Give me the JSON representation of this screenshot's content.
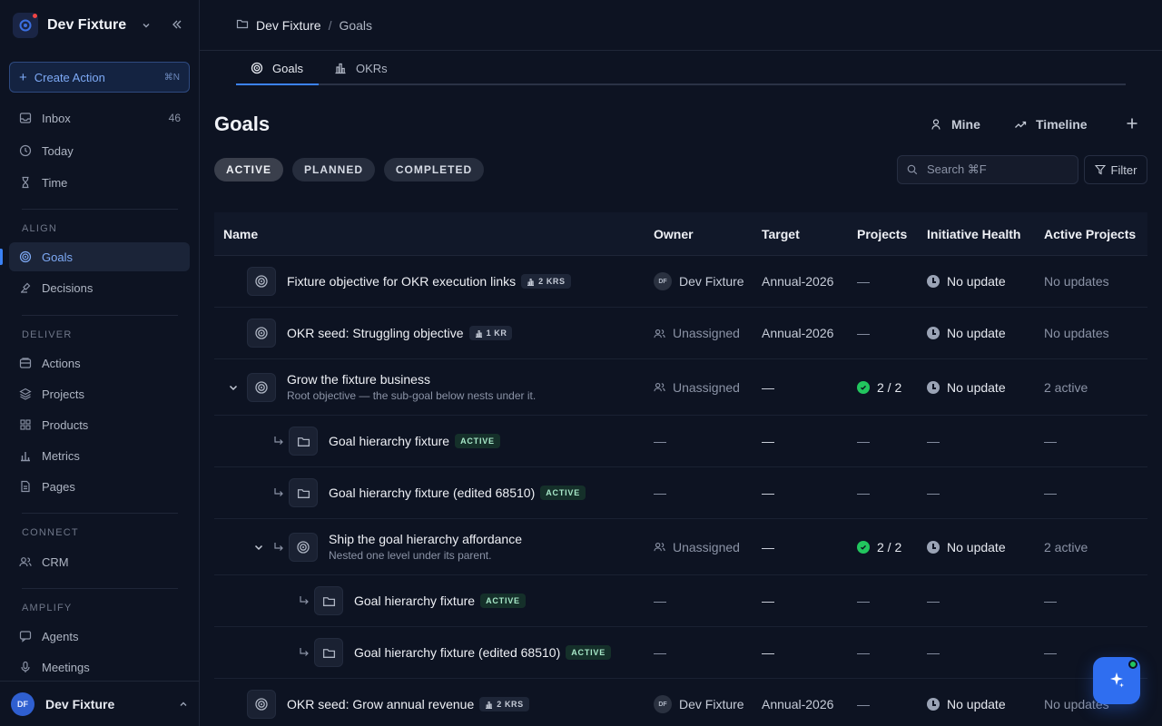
{
  "workspace": {
    "name": "Dev Fixture"
  },
  "sidebar": {
    "create_action": {
      "label": "Create Action",
      "shortcut": "⌘N"
    },
    "top_items": [
      {
        "label": "Inbox",
        "count": "46"
      },
      {
        "label": "Today"
      },
      {
        "label": "Time"
      }
    ],
    "sections": {
      "align": "ALIGN",
      "deliver": "DELIVER",
      "connect": "CONNECT",
      "amplify": "AMPLIFY"
    },
    "align_items": [
      {
        "label": "Goals"
      },
      {
        "label": "Decisions"
      }
    ],
    "deliver_items": [
      {
        "label": "Actions"
      },
      {
        "label": "Projects"
      },
      {
        "label": "Products"
      },
      {
        "label": "Metrics"
      },
      {
        "label": "Pages"
      }
    ],
    "connect_items": [
      {
        "label": "CRM"
      }
    ],
    "amplify_items": [
      {
        "label": "Agents"
      },
      {
        "label": "Meetings"
      }
    ],
    "user": {
      "initials": "DF",
      "name": "Dev Fixture"
    }
  },
  "breadcrumb": {
    "workspace": "Dev Fixture",
    "separator": "/",
    "page": "Goals"
  },
  "tabs": [
    {
      "label": "Goals"
    },
    {
      "label": "OKRs"
    }
  ],
  "header": {
    "title": "Goals",
    "mine_label": "Mine",
    "timeline_label": "Timeline"
  },
  "filters": {
    "pills": [
      "ACTIVE",
      "PLANNED",
      "COMPLETED"
    ],
    "search_placeholder": "Search ⌘F",
    "filter_label": "Filter"
  },
  "table": {
    "columns": [
      "Name",
      "Owner",
      "Target",
      "Projects",
      "Initiative Health",
      "Active Projects"
    ],
    "rows": [
      {
        "name": "Fixture objective for OKR execution links",
        "badge": "2 KRS",
        "owner": "Dev Fixture",
        "owner_initials": "DF",
        "target": "Annual-2026",
        "projects": "—",
        "health": "No update",
        "active": "No updates"
      },
      {
        "name": "OKR seed: Struggling objective",
        "badge": "1 KR",
        "owner": "Unassigned",
        "target": "Annual-2026",
        "projects": "—",
        "health": "No update",
        "active": "No updates"
      },
      {
        "name": "Grow the fixture business",
        "subtitle": "Root objective — the sub-goal below nests under it.",
        "owner": "Unassigned",
        "target": "—",
        "projects": "2 / 2",
        "health": "No update",
        "active": "2 active"
      },
      {
        "name": "Goal hierarchy fixture",
        "status": "ACTIVE",
        "owner": "—",
        "target": "—",
        "projects": "—",
        "health": "—",
        "active": "—"
      },
      {
        "name": "Goal hierarchy fixture (edited 68510)",
        "status": "ACTIVE",
        "owner": "—",
        "target": "—",
        "projects": "—",
        "health": "—",
        "active": "—"
      },
      {
        "name": "Ship the goal hierarchy affordance",
        "subtitle": "Nested one level under its parent.",
        "owner": "Unassigned",
        "target": "—",
        "projects": "2 / 2",
        "health": "No update",
        "active": "2 active"
      },
      {
        "name": "Goal hierarchy fixture",
        "status": "ACTIVE",
        "owner": "—",
        "target": "—",
        "projects": "—",
        "health": "—",
        "active": "—"
      },
      {
        "name": "Goal hierarchy fixture (edited 68510)",
        "status": "ACTIVE",
        "owner": "—",
        "target": "—",
        "projects": "—",
        "health": "—",
        "active": "—"
      },
      {
        "name": "OKR seed: Grow annual revenue",
        "badge": "2 KRS",
        "owner": "Dev Fixture",
        "owner_initials": "DF",
        "target": "Annual-2026",
        "projects": "—",
        "health": "No update",
        "active": "No updates"
      }
    ]
  },
  "colors": {
    "accent": "#3b82f6",
    "success": "#22c55e",
    "background": "#0d1322"
  },
  "icons": [
    "collapse-sidebar-icon",
    "target-icon",
    "folder-icon",
    "chart-icon",
    "sparkle-icon"
  ]
}
